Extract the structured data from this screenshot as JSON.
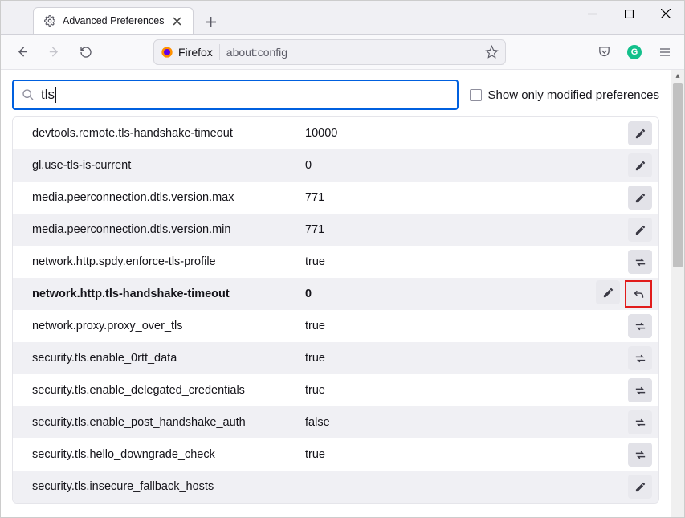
{
  "window": {
    "tab_title": "Advanced Preferences"
  },
  "toolbar": {
    "browser_name": "Firefox",
    "url": "about:config"
  },
  "search": {
    "value": "tls",
    "show_modified_label": "Show only modified preferences"
  },
  "prefs": [
    {
      "name": "devtools.remote.tls-handshake-timeout",
      "value": "10000",
      "action": "edit",
      "modified": false
    },
    {
      "name": "gl.use-tls-is-current",
      "value": "0",
      "action": "edit",
      "modified": false
    },
    {
      "name": "media.peerconnection.dtls.version.max",
      "value": "771",
      "action": "edit",
      "modified": false
    },
    {
      "name": "media.peerconnection.dtls.version.min",
      "value": "771",
      "action": "edit",
      "modified": false
    },
    {
      "name": "network.http.spdy.enforce-tls-profile",
      "value": "true",
      "action": "toggle",
      "modified": false
    },
    {
      "name": "network.http.tls-handshake-timeout",
      "value": "0",
      "action": "edit",
      "modified": true,
      "resettable": true
    },
    {
      "name": "network.proxy.proxy_over_tls",
      "value": "true",
      "action": "toggle",
      "modified": false
    },
    {
      "name": "security.tls.enable_0rtt_data",
      "value": "true",
      "action": "toggle",
      "modified": false
    },
    {
      "name": "security.tls.enable_delegated_credentials",
      "value": "true",
      "action": "toggle",
      "modified": false
    },
    {
      "name": "security.tls.enable_post_handshake_auth",
      "value": "false",
      "action": "toggle",
      "modified": false
    },
    {
      "name": "security.tls.hello_downgrade_check",
      "value": "true",
      "action": "toggle",
      "modified": false
    },
    {
      "name": "security.tls.insecure_fallback_hosts",
      "value": "",
      "action": "edit",
      "modified": false
    }
  ]
}
